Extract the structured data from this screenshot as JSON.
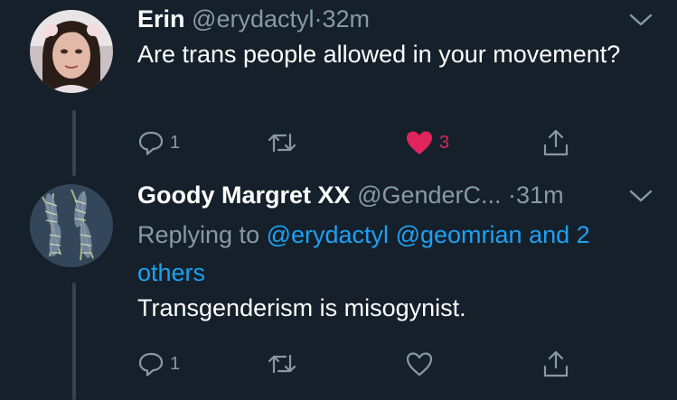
{
  "tweets": [
    {
      "name": "Erin",
      "handle": "@erydactyl",
      "separator": "·",
      "time": "32m",
      "text": "Are trans people allowed in your movement?",
      "replies": "1",
      "retweets": "",
      "likes": "3",
      "liked": true
    },
    {
      "name": "Goody Margret XX",
      "handle": "@GenderC...",
      "separator": "·",
      "time": "31m",
      "replying_prefix": "Replying to",
      "mention_1": "@erydactyl",
      "mention_2": "@geomrian",
      "mention_3": "and 2 others",
      "text": "Transgenderism is misogynist.",
      "replies": "1",
      "retweets": "",
      "likes": "",
      "liked": false
    }
  ],
  "icons": {
    "more": "chevron-down-icon",
    "reply": "reply-icon",
    "retweet": "retweet-icon",
    "like": "heart-icon",
    "share": "share-icon"
  },
  "colors": {
    "background": "#15202b",
    "secondary_text": "#8899a6",
    "link": "#1da1f2",
    "like_active": "#e0245e"
  }
}
